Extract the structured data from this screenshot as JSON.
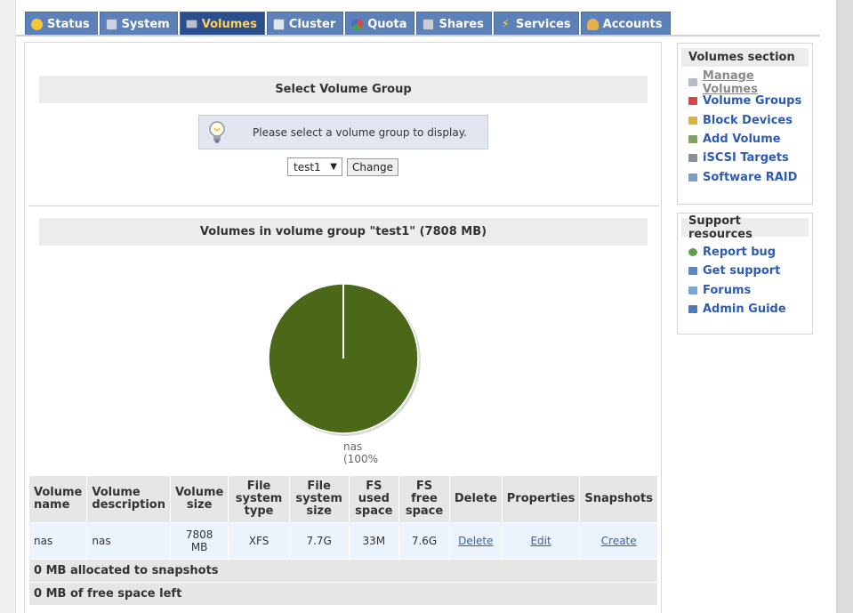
{
  "tabs": [
    {
      "label": "Status",
      "icon": "status-icon",
      "active": false
    },
    {
      "label": "System",
      "icon": "system-icon",
      "active": false
    },
    {
      "label": "Volumes",
      "icon": "volumes-icon",
      "active": true
    },
    {
      "label": "Cluster",
      "icon": "cluster-icon",
      "active": false
    },
    {
      "label": "Quota",
      "icon": "quota-icon",
      "active": false
    },
    {
      "label": "Shares",
      "icon": "shares-icon",
      "active": false
    },
    {
      "label": "Services",
      "icon": "services-icon",
      "active": false
    },
    {
      "label": "Accounts",
      "icon": "accounts-icon",
      "active": false
    }
  ],
  "select_section": {
    "title": "Select Volume Group",
    "info_text": "Please select a volume group to display.",
    "selected_group": "test1",
    "dropdown_arrow": "▼",
    "change_label": "Change"
  },
  "volumes_section": {
    "title": "Volumes in volume group \"test1\" (7808 MB)"
  },
  "chart_data": {
    "type": "pie",
    "slices": [
      {
        "label": "nas",
        "percent_label": "(100%",
        "value": 100,
        "color": "#4b6819"
      }
    ]
  },
  "table": {
    "headers": {
      "name": "Volume name",
      "description": "Volume description",
      "size": "Volume size",
      "fs_type": "File system type",
      "fs_size": "File system size",
      "fs_used": "FS used space",
      "fs_free": "FS free space",
      "delete": "Delete",
      "properties": "Properties",
      "snapshots": "Snapshots"
    },
    "rows": [
      {
        "name": "nas",
        "description": "nas",
        "size": "7808 MB",
        "fs_type": "XFS",
        "fs_size": "7.7G",
        "fs_used": "33M",
        "fs_free": "7.6G",
        "delete": "Delete",
        "properties": "Edit",
        "snapshots": "Create"
      }
    ],
    "snapshots_allocated": "0 MB allocated to snapshots",
    "free_space": "0 MB of free space left"
  },
  "sidebar": {
    "volumes_title": "Volumes section",
    "volumes_items": [
      {
        "label": "Manage Volumes",
        "icon": "manage-volumes-icon",
        "current": true
      },
      {
        "label": "Volume Groups",
        "icon": "volume-groups-icon",
        "current": false
      },
      {
        "label": "Block Devices",
        "icon": "block-devices-icon",
        "current": false
      },
      {
        "label": "Add Volume",
        "icon": "add-volume-icon",
        "current": false
      },
      {
        "label": "iSCSI Targets",
        "icon": "iscsi-targets-icon",
        "current": false
      },
      {
        "label": "Software RAID",
        "icon": "software-raid-icon",
        "current": false
      }
    ],
    "support_title": "Support resources",
    "support_items": [
      {
        "label": "Report bug",
        "icon": "bug-icon"
      },
      {
        "label": "Get support",
        "icon": "support-icon"
      },
      {
        "label": "Forums",
        "icon": "forums-icon"
      },
      {
        "label": "Admin Guide",
        "icon": "guide-icon"
      }
    ]
  },
  "colors": {
    "tab_bg": "#5c80b8",
    "tab_active_bg": "#2b4e8c",
    "tab_active_text": "#ffd15a",
    "link": "#2e5bb5",
    "pie_fill": "#4b6819"
  }
}
